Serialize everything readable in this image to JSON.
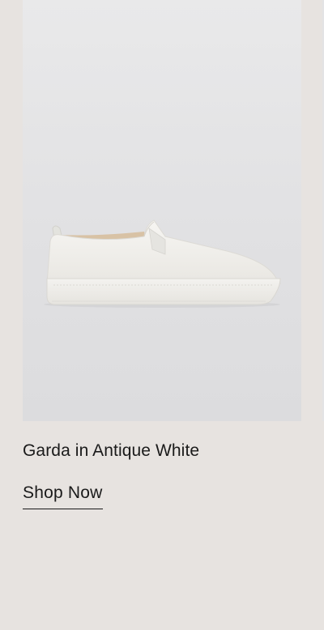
{
  "carousel": {
    "cards": [
      {
        "title": "Garda in Antique White",
        "cta_label": "Shop Now",
        "image_alt": "Garda slip-on sneaker in Antique White"
      },
      {
        "title": "",
        "cta_label": ""
      }
    ]
  },
  "colors": {
    "page_background": "#e7e3e0",
    "image_background": "#e3e3e5",
    "text": "#1a1a1a",
    "shoe": "#f2f0ec"
  }
}
